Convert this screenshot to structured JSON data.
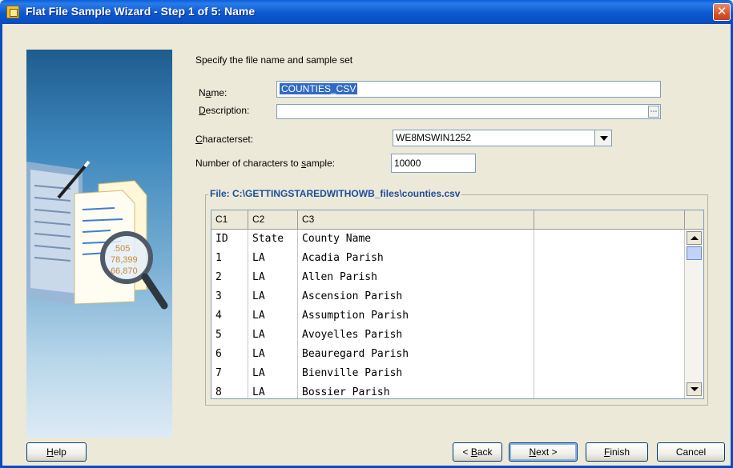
{
  "window": {
    "title": "Flat File Sample Wizard - Step 1 of 5: Name",
    "close_glyph": "✕"
  },
  "intro_text": "Specify the file name and sample set",
  "fields": {
    "name": {
      "label_prefix": "N",
      "label_u": "a",
      "label_rest": "me:",
      "value": "COUNTIES_CSV"
    },
    "description": {
      "label_u": "D",
      "label_rest": "escription:",
      "value": ""
    },
    "characterset": {
      "label_u": "C",
      "label_rest": "haracterset:",
      "value": "WE8MSWIN1252"
    },
    "sample_chars": {
      "label_prefix": "Number of characters to ",
      "label_u": "s",
      "label_rest": "ample:",
      "value": "10000"
    }
  },
  "file_group": {
    "title": "File: C:\\GETTINGSTAREDWITHOWB_files\\counties.csv"
  },
  "table": {
    "columns": [
      "C1",
      "C2",
      "C3",
      ""
    ],
    "rows": [
      [
        "ID",
        "State",
        "County Name",
        ""
      ],
      [
        "1",
        "LA",
        "Acadia Parish",
        ""
      ],
      [
        "2",
        "LA",
        "Allen Parish",
        ""
      ],
      [
        "3",
        "LA",
        "Ascension Parish",
        ""
      ],
      [
        "4",
        "LA",
        "Assumption Parish",
        ""
      ],
      [
        "5",
        "LA",
        "Avoyelles Parish",
        ""
      ],
      [
        "6",
        "LA",
        "Beauregard Parish",
        ""
      ],
      [
        "7",
        "LA",
        "Bienville Parish",
        ""
      ],
      [
        "8",
        "LA",
        "Bossier Parish",
        ""
      ]
    ]
  },
  "buttons": {
    "help": {
      "u": "H",
      "rest": "elp"
    },
    "back": {
      "prefix": "< ",
      "u": "B",
      "rest": "ack"
    },
    "next": {
      "u": "N",
      "rest": "ext >"
    },
    "finish": {
      "u": "F",
      "rest": "inish"
    },
    "cancel": {
      "label": "Cancel"
    }
  },
  "colors": {
    "titlebar": "#0A4CC0",
    "group_title": "#1D4E9E",
    "selection": "#316AC5"
  },
  "icons": [
    "app-icon",
    "close-icon",
    "dropdown-arrow-icon",
    "spinner-icon",
    "scroll-up-icon",
    "scroll-down-icon",
    "wizard-illustration-icon"
  ]
}
